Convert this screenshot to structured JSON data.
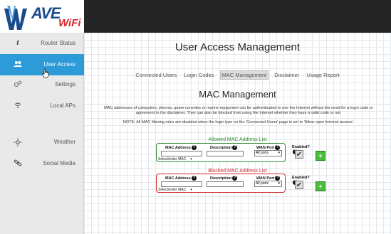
{
  "logo": {
    "main": "AVE",
    "sub": "WiFi"
  },
  "sidebar": {
    "items": [
      {
        "label": "Router Status",
        "icon": "info-icon"
      },
      {
        "label": "User Access",
        "icon": "users-icon",
        "active": true
      },
      {
        "label": "Settings",
        "icon": "gears-icon"
      },
      {
        "label": "Local APs",
        "icon": "wifi-icon"
      },
      {
        "label": "Weather",
        "icon": "sun-icon"
      },
      {
        "label": "Social Media",
        "icon": "link-icon"
      }
    ]
  },
  "page": {
    "title": "User Access Management",
    "tabs": [
      "Connected Users",
      "Login Codes",
      "MAC Management",
      "Disclaimer",
      "Usage Report"
    ],
    "selected_tab": "MAC Management",
    "section_title": "MAC Management",
    "description": "MAC addresses of computers, phones, game consoles or marine equipment can be authenticated to use the Internet without the need for a login code or agreement to the disclaimer. They can also be blocked from using the Internet whether they have a valid code or not.",
    "note": "NOTE: All MAC filtering rules are disabled when the login type on the 'Connected Users' page is set to 'Allow open Internet access'."
  },
  "allowed": {
    "caption": "Allowed MAC Address List",
    "headers": {
      "mac": "MAC Address",
      "description": "Description",
      "wan": "WAN Port",
      "enabled": "Enabled?"
    },
    "mac_select": "Select/enter MAC",
    "wan_value": "All ports",
    "add_label": "+"
  },
  "blocked": {
    "caption": "Blocked MAC Address List",
    "headers": {
      "mac": "MAC Address",
      "description": "Description",
      "wan": "WAN Port",
      "enabled": "Enabled?"
    },
    "mac_select": "Select/enter MAC",
    "wan_value": "All ports",
    "add_label": "+"
  },
  "colors": {
    "accent": "#2d9bd8",
    "allowed": "#2e8b2e",
    "blocked": "#cc2a2a",
    "add_button": "#4cba3a"
  }
}
